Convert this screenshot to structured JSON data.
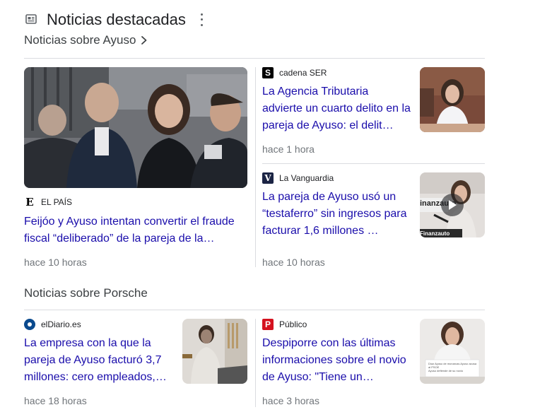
{
  "header": {
    "title": "Noticias destacadas",
    "icon": "news-icon",
    "menu_icon": "more-vert-icon"
  },
  "section1": {
    "title": "Noticias sobre Ayuso",
    "chevron": "chevron-right-icon"
  },
  "section2": {
    "title": "Noticias sobre Porsche"
  },
  "articles": [
    {
      "source": "EL PAÍS",
      "logo_char": "E",
      "logo_style": "blackletter-e",
      "headline": "Feijóo y Ayuso intentan convertir el fraude fiscal “deliberado” de la pareja de la…",
      "time": "hace 10 horas"
    },
    {
      "source": "cadena SER",
      "logo_char": "S",
      "logo_style": "ser-square",
      "headline": "La Agencia Tributaria advierte un cuarto delito en la pareja de Ayuso: el delit…",
      "time": "hace 1 hora"
    },
    {
      "source": "La Vanguardia",
      "logo_char": "V",
      "logo_style": "navy-square",
      "headline": "La pareja de Ayuso usó un “testaferro” sin ingresos para facturar 1,6 millones …",
      "time": "hace 10 horas"
    },
    {
      "source": "elDiario.es",
      "logo_char": "",
      "logo_style": "blue-circle",
      "headline": "La empresa con la que la pareja de Ayuso facturó 3,7 millones: cero empleados,…",
      "time": "hace 18 horas"
    },
    {
      "source": "Público",
      "logo_char": "P",
      "logo_style": "red-square",
      "headline": "Despiporre con las últimas informaciones sobre el novio de Ayuso: \"Tiene un…",
      "time": "hace 3 horas"
    }
  ],
  "thumbnail_text": {
    "video_banner": "inanzauto",
    "video_banner_2": "Finanzauto",
    "caption_line_1": "Díaz Ayuso de monarcas Ayuso acusa al PSOE",
    "caption_line_2": "Ayuso defiende de su novio"
  },
  "colors": {
    "link": "#1a0dab",
    "muted": "#70757a",
    "divider": "#dadce0",
    "elpais": "#000000",
    "ser": "#000000",
    "vanguardia": "#1b2444",
    "eldiario": "#0a4a8e",
    "publico": "#d4121f"
  }
}
